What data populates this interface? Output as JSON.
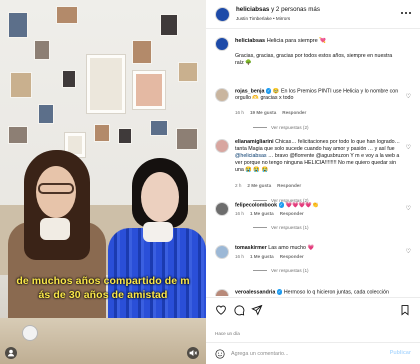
{
  "video": {
    "subtitle_line1": "de muchos años compartido de m",
    "subtitle_line2": "ás de 30 años de amistad"
  },
  "header": {
    "account": "heliciabsas",
    "coauthors": " y 2 personas más",
    "audio": "Justin Timberlake • Mirrors",
    "more_icon": "more-horizontal-icon"
  },
  "caption": {
    "user": "heliciabsas",
    "title": "Helicia para siempre",
    "emoji": "💘",
    "body": "Gracias, gracias, gracias por todos estos años, siempre en nuestra raíz",
    "body_emoji": "🌳"
  },
  "comments": [
    {
      "user": "rojas_benja",
      "verified": true,
      "text_pre": "🥹 En los Premios PINTI use Helicia y lo nombre con orgullo 🫶 gracias x todo",
      "mention": "",
      "text_post": "",
      "time": "16 h",
      "likes": "19 Me gusta",
      "reply": "Responder",
      "replies": "Ver respuestas (2)"
    },
    {
      "user": "elianamigliarini",
      "verified": false,
      "text_pre": "Chicas… felicitaciones por todo lo que han logrado… tanta Magia que solo sucede cuando hay amor y pasión … y así fue ",
      "mention": "@heliciabsas",
      "text_post": " … bravo @florrente @agusbruzon Y m e voy a la web a ver porque no tengo ninguna HELICIA!!!!!!!! No me quiero quedar sin una 😭 😭 😭",
      "time": "2 h",
      "likes": "2 Me gusta",
      "reply": "Responder",
      "replies": "Ver respuestas (2)"
    },
    {
      "user": "felipecolombook",
      "verified": true,
      "text_pre": "💗💗💗💗👏",
      "mention": "",
      "text_post": "",
      "time": "16 h",
      "likes": "1 Me gusta",
      "reply": "Responder",
      "replies": "Ver respuestas (1)"
    },
    {
      "user": "tomaskirmer",
      "verified": false,
      "text_pre": "Las amo mucho 💗",
      "mention": "",
      "text_post": "",
      "time": "16 h",
      "likes": "1 Me gusta",
      "reply": "Responder",
      "replies": "Ver respuestas (1)"
    },
    {
      "user": "veroalessandria",
      "verified": true,
      "text_pre": "Hermoso lo q hicieron juntas, cada colección",
      "mention": "",
      "text_post": "",
      "time": "",
      "likes": "",
      "reply": "",
      "replies": ""
    }
  ],
  "post_time": "Hace un día",
  "composer": {
    "placeholder": "Agrega un comentario...",
    "post": "Publicar"
  },
  "colors": {
    "link": "#00376b",
    "subtitle": "#fbe84a",
    "verified": "#1d9bf0"
  }
}
